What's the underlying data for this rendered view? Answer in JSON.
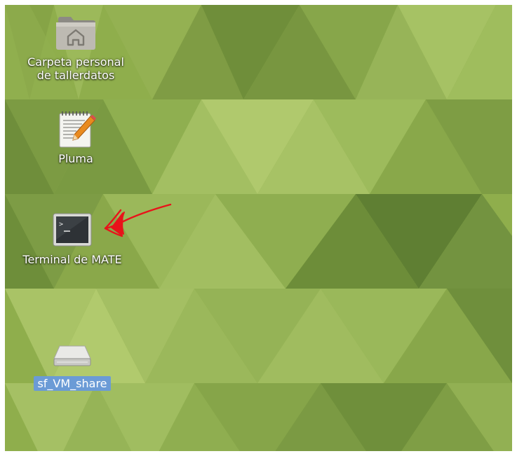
{
  "desktop": {
    "icons": [
      {
        "name": "home-folder",
        "label_line1": "Carpeta personal",
        "label_line2": "de tallerdatos",
        "icon": "home-folder-icon"
      },
      {
        "name": "pluma",
        "label": "Pluma",
        "icon": "text-editor-icon"
      },
      {
        "name": "terminal",
        "label": "Terminal de MATE",
        "icon": "terminal-icon"
      },
      {
        "name": "sf-vm-share",
        "label": "sf_VM_share",
        "icon": "drive-icon",
        "selected": true
      }
    ]
  },
  "annotation": {
    "type": "hand-drawn-arrow",
    "color": "#e8131a"
  }
}
